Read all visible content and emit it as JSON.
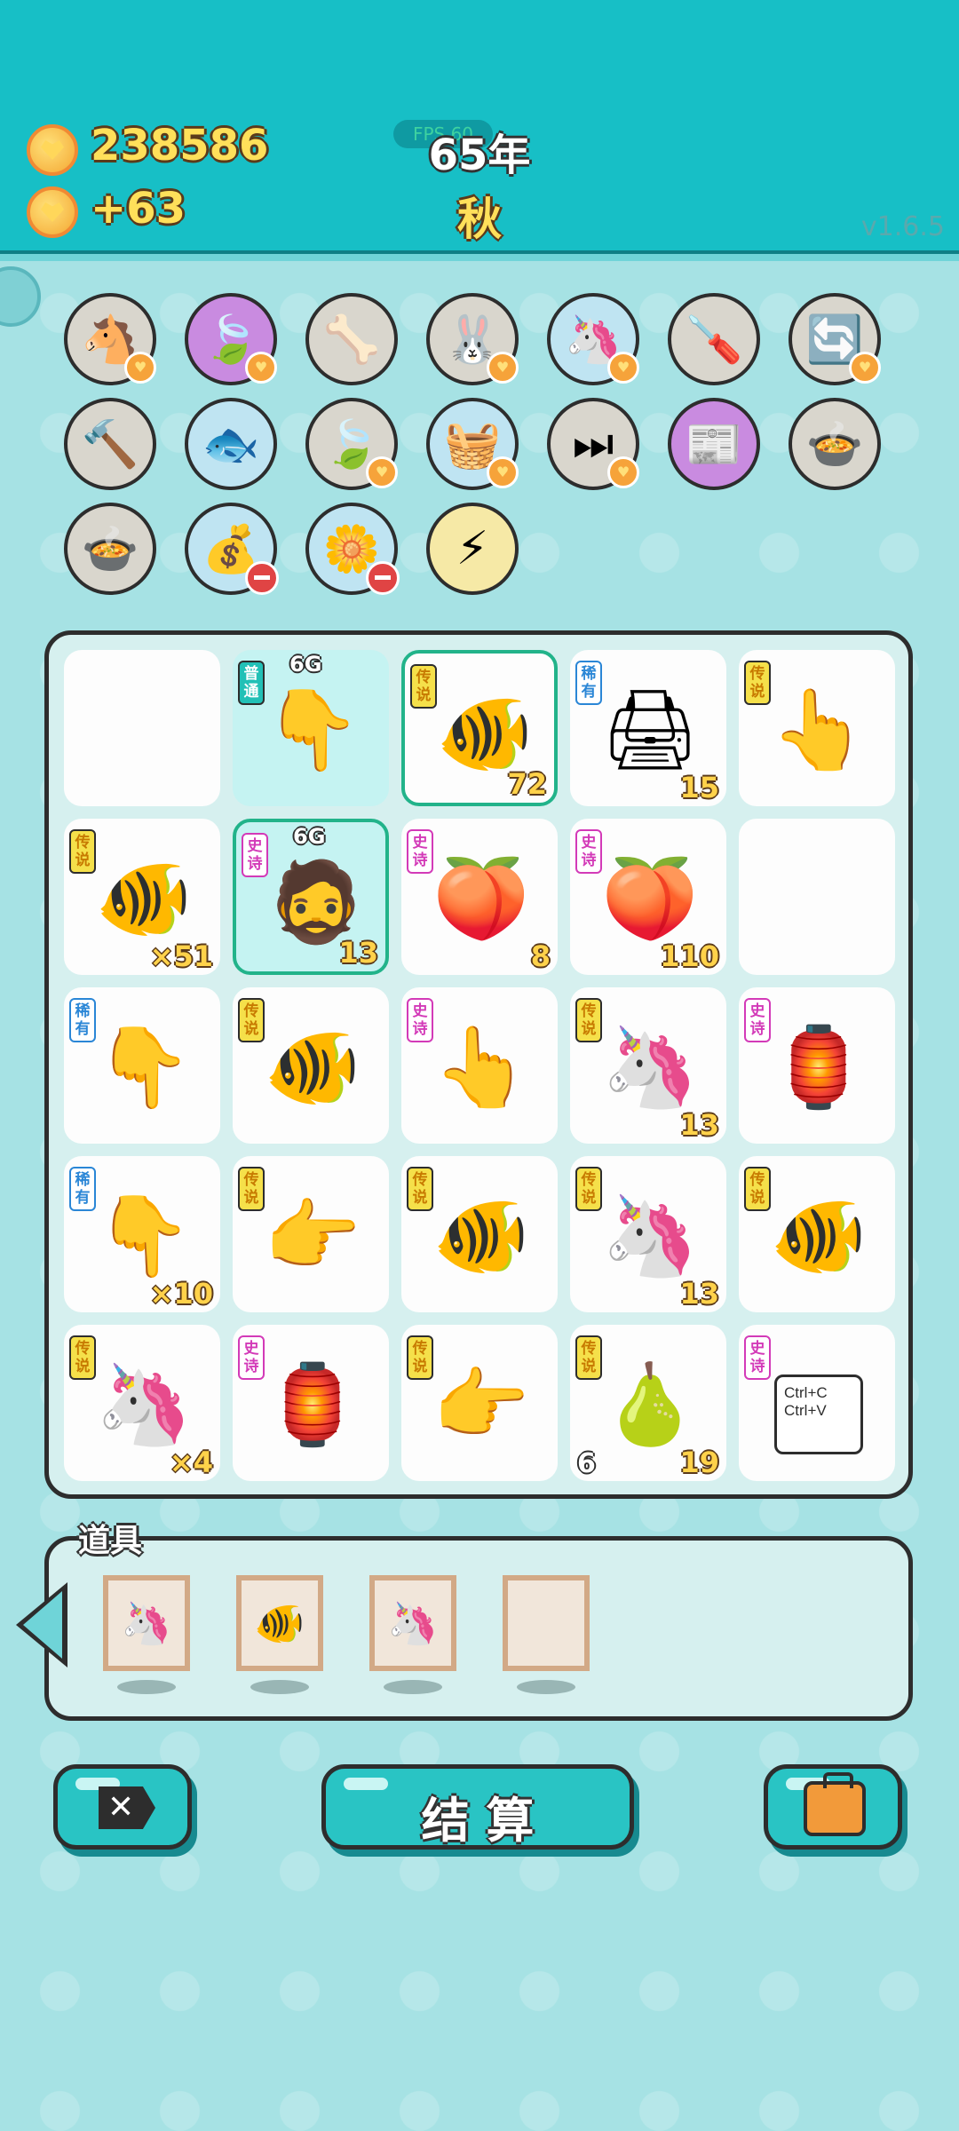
{
  "header": {
    "coins": "238586",
    "income": "+63",
    "fps_label": "FPS 60",
    "year": "65年",
    "season": "秋",
    "version": "v1.6.5"
  },
  "relics": [
    {
      "icon": "🐴",
      "emoji_name": "twin-unicorn-icon",
      "heart": true,
      "bg": "#d9d6cd"
    },
    {
      "icon": "🍃",
      "emoji_name": "leaf-icon",
      "heart": true,
      "bg": "#c98be0"
    },
    {
      "icon": "🦴",
      "emoji_name": "pet-bowl-icon",
      "heart": false,
      "bg": "#d9d6cd"
    },
    {
      "icon": "🐰",
      "emoji_name": "bunny-icon",
      "heart": true,
      "bg": "#d9d6cd"
    },
    {
      "icon": "🦄",
      "emoji_name": "twin-unicorn-icon",
      "heart": true,
      "bg": "#bfe4f2"
    },
    {
      "icon": "🪛",
      "emoji_name": "screwdriver-icon",
      "heart": false,
      "bg": "#d9d6cd"
    },
    {
      "icon": "🔄",
      "emoji_name": "recycle-icon",
      "heart": true,
      "bg": "#d9d6cd"
    },
    {
      "icon": "🔨",
      "emoji_name": "hammer-icon",
      "heart": false,
      "bg": "#d9d6cd"
    },
    {
      "icon": "🐟",
      "emoji_name": "fish-bowl-icon",
      "heart": false,
      "bg": "#bfe4f2"
    },
    {
      "icon": "🍃",
      "emoji_name": "leaf-icon",
      "heart": true,
      "bg": "#d9d6cd"
    },
    {
      "icon": "🧺",
      "emoji_name": "fruit-basket-icon",
      "heart": true,
      "bg": "#bfe4f2"
    },
    {
      "icon": "⏭",
      "emoji_name": "skip-icon",
      "heart": true,
      "bg": "#d9d6cd"
    },
    {
      "icon": "📰",
      "emoji_name": "time-magazine-icon",
      "heart": false,
      "bg": "#c98be0"
    },
    {
      "icon": "🍲",
      "emoji_name": "duck-pot-icon",
      "heart": false,
      "bg": "#d9d6cd"
    },
    {
      "icon": "🍲",
      "emoji_name": "duck-pot-icon",
      "heart": false,
      "bg": "#d9d6cd"
    },
    {
      "icon": "💰",
      "emoji_name": "money-bag-icon",
      "minus": true,
      "bg": "#bfe4f2"
    },
    {
      "icon": "🌼",
      "emoji_name": "potted-flower-icon",
      "minus": true,
      "bg": "#bfe4f2"
    },
    {
      "icon": "⚡",
      "emoji_name": "lightning-icon",
      "heart": false,
      "bg": "#f6e9a6"
    }
  ],
  "grid": [
    {
      "tag": "",
      "cls": "",
      "icon": "",
      "name": "empty-icon",
      "num": ""
    },
    {
      "tag": "普通",
      "cls": "common",
      "icon": "👇",
      "name": "pointing-hand-icon",
      "num": "",
      "sixg": "6G",
      "hl": true
    },
    {
      "tag": "传说",
      "cls": "legend",
      "icon": "🐠",
      "name": "koi-fish-icon",
      "num": "72",
      "sel": true
    },
    {
      "tag": "稀有",
      "cls": "rare",
      "icon": "🖨",
      "name": "printer-icon",
      "num": "15"
    },
    {
      "tag": "传说",
      "cls": "legend",
      "icon": "👆",
      "name": "pointing-up-hand-icon",
      "num": ""
    },
    {
      "tag": "传说",
      "cls": "legend",
      "icon": "🐠",
      "name": "koi-fish-icon",
      "num": "×51"
    },
    {
      "tag": "史诗",
      "cls": "epic",
      "icon": "🧔",
      "name": "bearded-man-icon",
      "num": "13",
      "sixg": "6G",
      "hl": true,
      "sel": true
    },
    {
      "tag": "史诗",
      "cls": "epic",
      "icon": "🍑",
      "name": "peach-icon",
      "num": "8"
    },
    {
      "tag": "史诗",
      "cls": "epic",
      "icon": "🍑",
      "name": "peach-icon",
      "num": "110"
    },
    {
      "tag": "",
      "cls": "",
      "icon": "",
      "name": "empty-icon",
      "num": ""
    },
    {
      "tag": "稀有",
      "cls": "rare",
      "icon": "👇",
      "name": "brown-hand-icon",
      "num": ""
    },
    {
      "tag": "传说",
      "cls": "legend",
      "icon": "🐠",
      "name": "koi-fish-icon",
      "num": ""
    },
    {
      "tag": "史诗",
      "cls": "epic",
      "icon": "👆",
      "name": "gray-hand-icon",
      "num": ""
    },
    {
      "tag": "传说",
      "cls": "legend",
      "icon": "🦄",
      "name": "unicorn-icon",
      "num": "13"
    },
    {
      "tag": "史诗",
      "cls": "epic",
      "icon": "🏮",
      "name": "bunny-house-icon",
      "num": ""
    },
    {
      "tag": "稀有",
      "cls": "rare",
      "icon": "👇",
      "name": "brown-hand-icon",
      "num": "×10"
    },
    {
      "tag": "传说",
      "cls": "legend",
      "icon": "👉",
      "name": "pointing-right-hand-icon",
      "num": ""
    },
    {
      "tag": "传说",
      "cls": "legend",
      "icon": "🐠",
      "name": "koi-fish-icon",
      "num": ""
    },
    {
      "tag": "传说",
      "cls": "legend",
      "icon": "🦄",
      "name": "unicorn-icon",
      "num": "13"
    },
    {
      "tag": "传说",
      "cls": "legend",
      "icon": "🐠",
      "name": "koi-fish-icon",
      "num": ""
    },
    {
      "tag": "传说",
      "cls": "legend",
      "icon": "🦄",
      "name": "unicorn-icon",
      "num": "×4"
    },
    {
      "tag": "史诗",
      "cls": "epic",
      "icon": "🏮",
      "name": "bunny-house-icon",
      "num": ""
    },
    {
      "tag": "传说",
      "cls": "legend",
      "icon": "👉",
      "name": "pointing-hand-icon",
      "num": ""
    },
    {
      "tag": "传说",
      "cls": "legend",
      "icon": "🍐",
      "name": "pear-icon",
      "num": "19",
      "numl": "6"
    },
    {
      "tag": "史诗",
      "cls": "epic",
      "icon": "📋",
      "name": "copy-paste-icon",
      "num": "",
      "text": "Ctrl+C Ctrl+V"
    }
  ],
  "items": {
    "title": "道具",
    "slots": [
      {
        "icon": "🦄",
        "name": "unicorn-frame-icon"
      },
      {
        "icon": "🐠",
        "name": "fish-frame-icon"
      },
      {
        "icon": "🦄",
        "name": "unicorn-frame-icon"
      },
      {
        "icon": "",
        "name": "empty-frame-icon"
      }
    ]
  },
  "buttons": {
    "settle": "结 算"
  }
}
